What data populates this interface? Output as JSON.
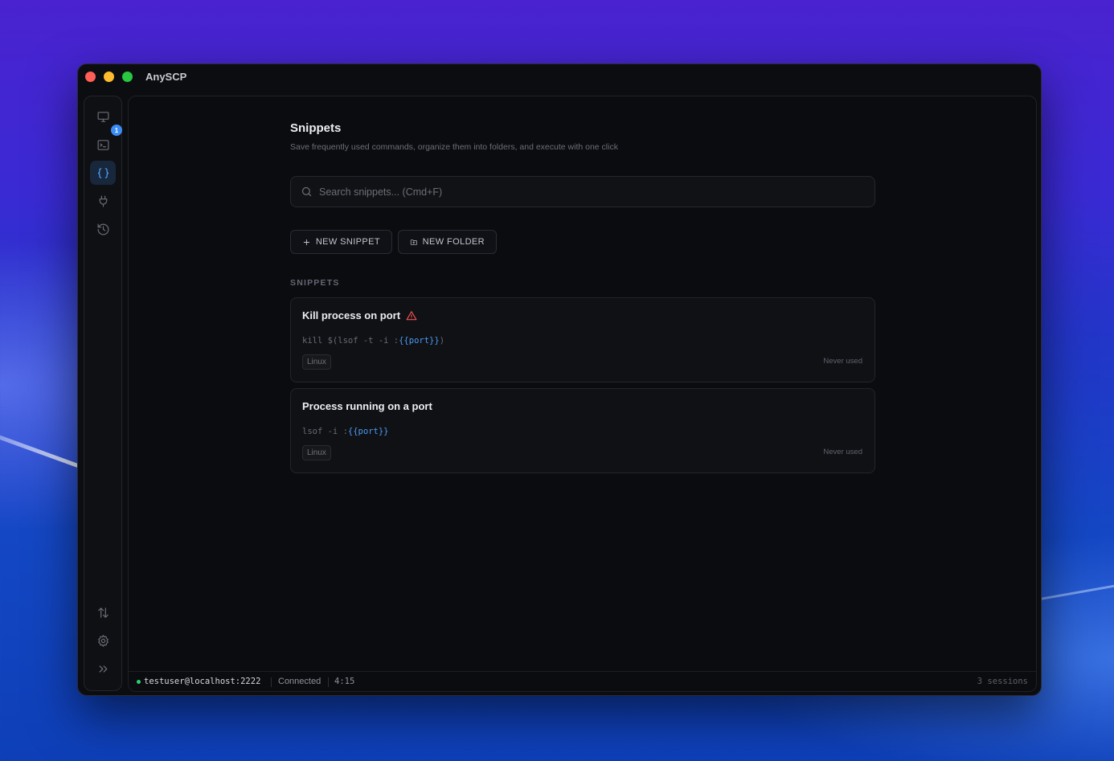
{
  "app": {
    "title": "AnySCP"
  },
  "sidebar": {
    "items": [
      {
        "name": "hosts",
        "icon": "monitor-icon"
      },
      {
        "name": "terminal",
        "icon": "terminal-icon",
        "badge": "1"
      },
      {
        "name": "snippets",
        "icon": "braces-icon",
        "active": true
      },
      {
        "name": "port-forwarding",
        "icon": "plug-icon"
      },
      {
        "name": "history",
        "icon": "history-icon"
      }
    ],
    "bottom_items": [
      {
        "name": "transfers",
        "icon": "transfer-arrows-icon"
      },
      {
        "name": "settings",
        "icon": "gear-icon"
      },
      {
        "name": "expand",
        "icon": "chevrons-right-icon"
      }
    ]
  },
  "page": {
    "title": "Snippets",
    "subtitle": "Save frequently used commands, organize them into folders, and execute with one click"
  },
  "search": {
    "placeholder": "Search snippets... (Cmd+F)",
    "value": ""
  },
  "actions": {
    "new_snippet": "NEW SNIPPET",
    "new_folder": "NEW FOLDER"
  },
  "section_label": "SNIPPETS",
  "snippets": [
    {
      "title": "Kill process on port",
      "warning": true,
      "cmd_prefix": "kill $(lsof -t -i :",
      "cmd_var": "{{port}}",
      "cmd_suffix": ")",
      "tag": "Linux",
      "usage": "Never used"
    },
    {
      "title": "Process running on a port",
      "warning": false,
      "cmd_prefix": "lsof -i :",
      "cmd_var": "{{port}}",
      "cmd_suffix": "",
      "tag": "Linux",
      "usage": "Never used"
    }
  ],
  "status": {
    "user": "testuser@localhost:2222",
    "connection": "Connected",
    "time": "4:15",
    "sessions": "3 sessions"
  },
  "colors": {
    "accent": "#4b9bf5",
    "badge": "#3b8df5",
    "connected": "#2fcf70",
    "warning": "#f05252"
  }
}
